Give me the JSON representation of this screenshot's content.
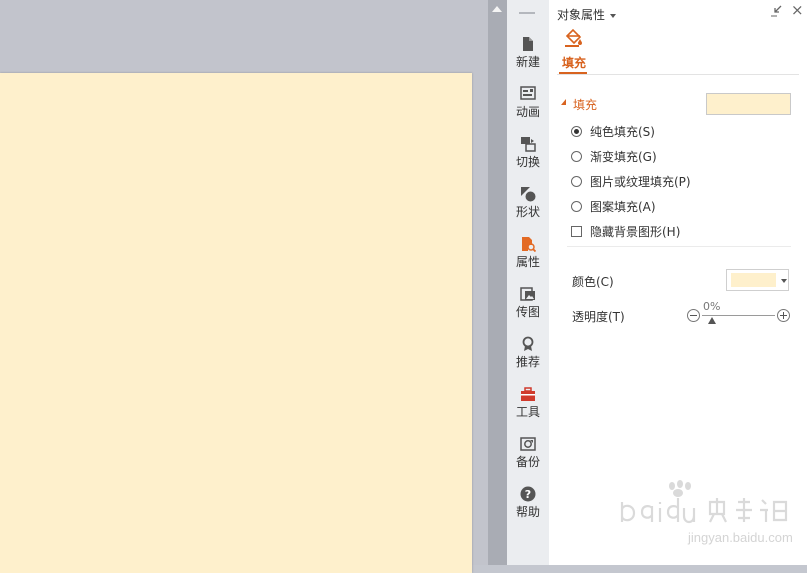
{
  "panel": {
    "title": "对象属性",
    "tab_label": "填充",
    "section_title": "填充",
    "fill_options": [
      {
        "label": "纯色填充(S)",
        "selected": true
      },
      {
        "label": "渐变填充(G)",
        "selected": false
      },
      {
        "label": "图片或纹理填充(P)",
        "selected": false
      },
      {
        "label": "图案填充(A)",
        "selected": false
      }
    ],
    "hide_background_label": "隐藏背景图形(H)",
    "hide_background_checked": false,
    "color_label": "颜色(C)",
    "transparency_label": "透明度(T)",
    "transparency_value": "0%",
    "transparency_level": 0
  },
  "colors": {
    "slide_fill": "#fef0cc",
    "accent": "#d8631f"
  },
  "tool_rail": {
    "items": [
      {
        "label": "新建",
        "icon": "new-file-icon"
      },
      {
        "label": "动画",
        "icon": "animation-icon"
      },
      {
        "label": "切换",
        "icon": "transition-icon"
      },
      {
        "label": "形状",
        "icon": "shapes-icon"
      },
      {
        "label": "属性",
        "icon": "properties-icon",
        "active": true
      },
      {
        "label": "传图",
        "icon": "upload-image-icon"
      },
      {
        "label": "推荐",
        "icon": "recommend-icon"
      },
      {
        "label": "工具",
        "icon": "toolbox-icon"
      },
      {
        "label": "备份",
        "icon": "backup-icon"
      },
      {
        "label": "帮助",
        "icon": "help-icon"
      }
    ]
  },
  "watermark": {
    "text": "jingyan.baidu.com"
  }
}
